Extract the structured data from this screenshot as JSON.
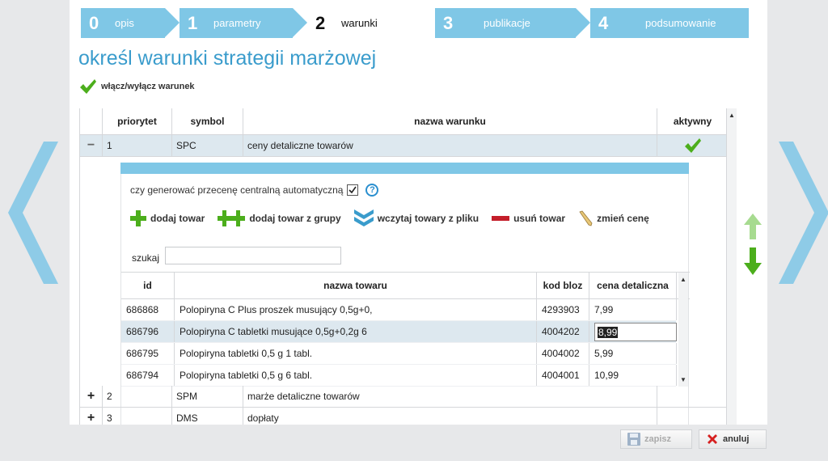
{
  "steps": [
    {
      "num": "0",
      "label": "opis"
    },
    {
      "num": "1",
      "label": "parametry"
    },
    {
      "num": "2",
      "label": "warunki"
    },
    {
      "num": "3",
      "label": "publikacje"
    },
    {
      "num": "4",
      "label": "podsumowanie"
    }
  ],
  "page_title": "określ warunki strategii marżowej",
  "toggle_label": "włącz/wyłącz warunek",
  "grid": {
    "headers": {
      "priority": "priorytet",
      "symbol": "symbol",
      "name": "nazwa warunku",
      "active": "aktywny"
    },
    "rows": [
      {
        "expander": "−",
        "priority": "1",
        "symbol": "SPC",
        "name": "ceny detaliczne towarów",
        "active": true
      },
      {
        "expander": "+",
        "priority": "2",
        "symbol": "SPM",
        "name": "marże detaliczne towarów",
        "active": false
      },
      {
        "expander": "+",
        "priority": "3",
        "symbol": "DMS",
        "name": "dopłaty",
        "active": false
      }
    ]
  },
  "detail": {
    "auto_question": "czy generować przecenę centralną automatyczną",
    "auto_checked": true,
    "toolbar": {
      "add_item": "dodaj towar",
      "add_group": "dodaj towar z grupy",
      "load_file": "wczytaj towary z pliku",
      "remove_item": "usuń towar",
      "change_price": "zmień cenę"
    },
    "search_label": "szukaj",
    "search_value": "",
    "table": {
      "headers": {
        "id": "id",
        "name": "nazwa towaru",
        "code": "kod bloz",
        "price": "cena detaliczna"
      },
      "rows": [
        {
          "id": "686868",
          "name": "Polopiryna C Plus proszek musujący 0,5g+0,",
          "code": "4293903",
          "price": "7,99"
        },
        {
          "id": "686796",
          "name": "Polopiryna C tabletki musujące 0,5g+0,2g 6",
          "code": "4004202",
          "price": "8,99"
        },
        {
          "id": "686795",
          "name": "Polopiryna tabletki 0,5 g 1 tabl.",
          "code": "4004002",
          "price": "5,99"
        },
        {
          "id": "686794",
          "name": "Polopiryna tabletki 0,5 g 6 tabl.",
          "code": "4004001",
          "price": "10,99"
        }
      ]
    }
  },
  "footer": {
    "save": "zapisz",
    "cancel": "anuluj"
  },
  "colors": {
    "accent": "#7fc7e6",
    "title": "#3a9ccc",
    "check": "#4cae1c",
    "remove": "#c41e2a",
    "cancel": "#d62020"
  }
}
